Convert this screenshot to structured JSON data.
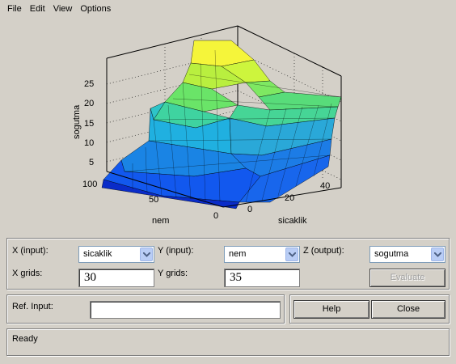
{
  "menu": [
    "File",
    "Edit",
    "View",
    "Options"
  ],
  "plot": {
    "zlabel": "sogutma",
    "xlabel": "sicaklik",
    "ylabel": "nem",
    "z_ticks": [
      "5",
      "10",
      "15",
      "20",
      "25"
    ],
    "x_ticks": [
      "0",
      "20",
      "40"
    ],
    "y_ticks": [
      "0",
      "50",
      "100"
    ]
  },
  "controls": {
    "x_input_label": "X (input):",
    "x_input_value": "sicaklik",
    "y_input_label": "Y (input):",
    "y_input_value": "nem",
    "z_output_label": "Z (output):",
    "z_output_value": "sogutma",
    "x_grids_label": "X grids:",
    "x_grids_value": "30",
    "y_grids_label": "Y grids:",
    "y_grids_value": "35",
    "evaluate_label": "Evaluate"
  },
  "ref": {
    "label": "Ref. Input:",
    "value": "",
    "help_label": "Help",
    "close_label": "Close"
  },
  "status": "Ready"
}
